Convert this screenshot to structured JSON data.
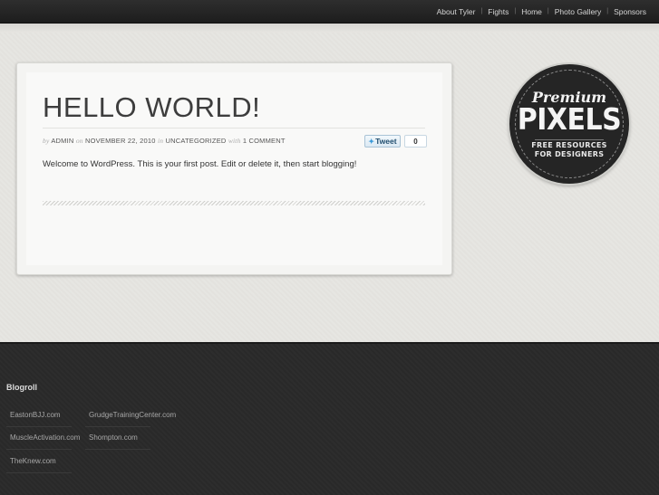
{
  "nav": {
    "items": [
      "About Tyler",
      "Fights",
      "Home",
      "Photo Gallery",
      "Sponsors"
    ],
    "separator": "|"
  },
  "post": {
    "title": "HELLO WORLD!",
    "meta": {
      "by": "by",
      "author": "ADMIN",
      "on": "on",
      "date": "NOVEMBER 22, 2010",
      "in": "in",
      "category": "UNCATEGORIZED",
      "with": "with",
      "comments": "1 COMMENT"
    },
    "tweet_label": "Tweet",
    "tweet_count": "0",
    "body": "Welcome to WordPress. This is your first post. Edit or delete it, then start blogging!"
  },
  "badge": {
    "script": "Premium",
    "big": "PIXELS",
    "line1": "FREE RESOURCES",
    "line2": "FOR DESIGNERS"
  },
  "footer": {
    "title": "Blogroll",
    "links": [
      "EastonBJJ.com",
      "GrudgeTrainingCenter.com",
      "MuscleActivation.com",
      "Shompton.com",
      "TheKnew.com"
    ]
  },
  "colors": {
    "topbar": "#1d1d1d",
    "page_bg": "#e6e5e1",
    "footer_bg": "#2a2a2a",
    "tweet_blue": "#3a9ad9"
  }
}
